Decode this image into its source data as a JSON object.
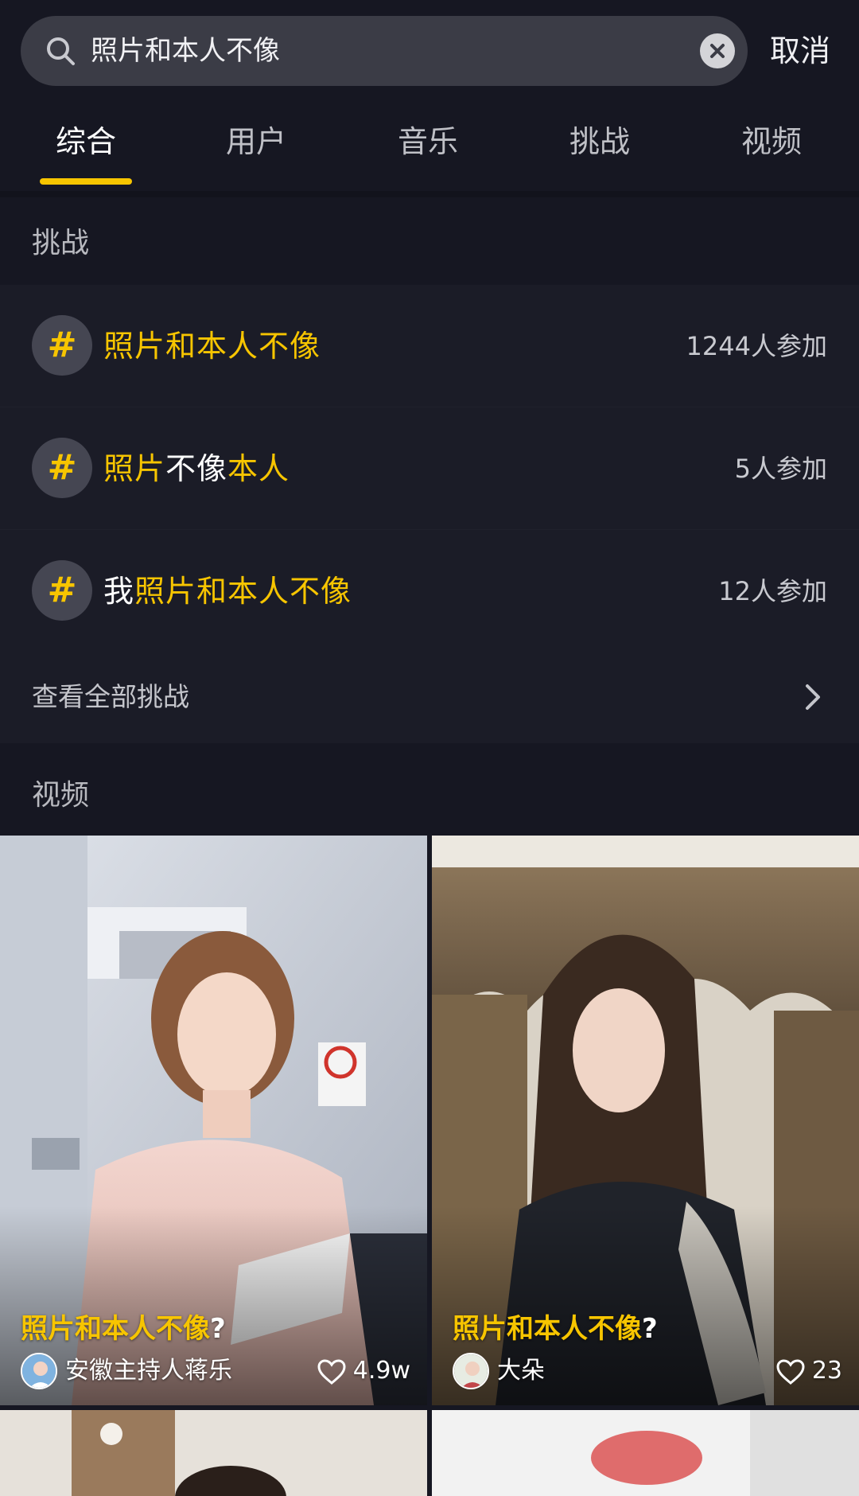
{
  "search": {
    "query": "照片和本人不像",
    "cancel_label": "取消"
  },
  "tabs": [
    {
      "label": "综合",
      "active": true
    },
    {
      "label": "用户",
      "active": false
    },
    {
      "label": "音乐",
      "active": false
    },
    {
      "label": "挑战",
      "active": false
    },
    {
      "label": "视频",
      "active": false
    }
  ],
  "challenges_section": {
    "title": "挑战",
    "items": [
      {
        "parts": [
          {
            "text": "照片和本人不像",
            "highlight": true
          }
        ],
        "count": "1244人参加"
      },
      {
        "parts": [
          {
            "text": "照片",
            "highlight": true
          },
          {
            "text": "不像",
            "highlight": false
          },
          {
            "text": "本人",
            "highlight": true
          }
        ],
        "count": "5人参加"
      },
      {
        "parts": [
          {
            "text": "我",
            "highlight": false
          },
          {
            "text": "照片和本人不像",
            "highlight": true
          }
        ],
        "count": "12人参加"
      }
    ],
    "view_all_label": "查看全部挑战"
  },
  "videos_section": {
    "title": "视频",
    "items": [
      {
        "title_highlight": "照片和本人不像",
        "title_suffix": "?",
        "author": "安徽主持人蒋乐",
        "likes": "4.9w"
      },
      {
        "title_highlight": "照片和本人不像",
        "title_suffix": "?",
        "author": "大朵",
        "likes": "23"
      }
    ]
  },
  "colors": {
    "background": "#161722",
    "accent": "#f7c500",
    "row_background": "#1b1c27",
    "search_background": "#3b3c46"
  }
}
